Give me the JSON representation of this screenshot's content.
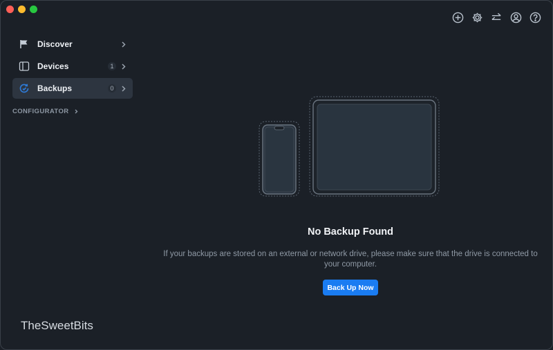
{
  "window": {
    "controls": [
      "close",
      "minimize",
      "maximize"
    ]
  },
  "toolbar": {
    "buttons": [
      {
        "icon": "plus-circle-icon"
      },
      {
        "icon": "gear-icon"
      },
      {
        "icon": "transfer-arrows-icon"
      },
      {
        "icon": "user-account-icon"
      },
      {
        "icon": "help-icon"
      }
    ]
  },
  "sidebar": {
    "items": [
      {
        "label": "Discover",
        "badge": "",
        "icon": "flag-icon",
        "active": false
      },
      {
        "label": "Devices",
        "badge": "1",
        "icon": "devices-icon",
        "active": false
      },
      {
        "label": "Backups",
        "badge": "0",
        "icon": "backup-sync-icon",
        "active": true
      }
    ],
    "section": {
      "label": "CONFIGURATOR"
    }
  },
  "main": {
    "empty_state": {
      "title": "No Backup Found",
      "description": "If your backups are stored on an external or network drive, please make sure that the drive is connected to your computer.",
      "button_label": "Back Up Now"
    }
  },
  "watermark": "TheSweetBits",
  "colors": {
    "background": "#1b2027",
    "sidebar_active": "#2d3540",
    "accent": "#1a7cf2",
    "backup_icon": "#2e7ad6"
  }
}
